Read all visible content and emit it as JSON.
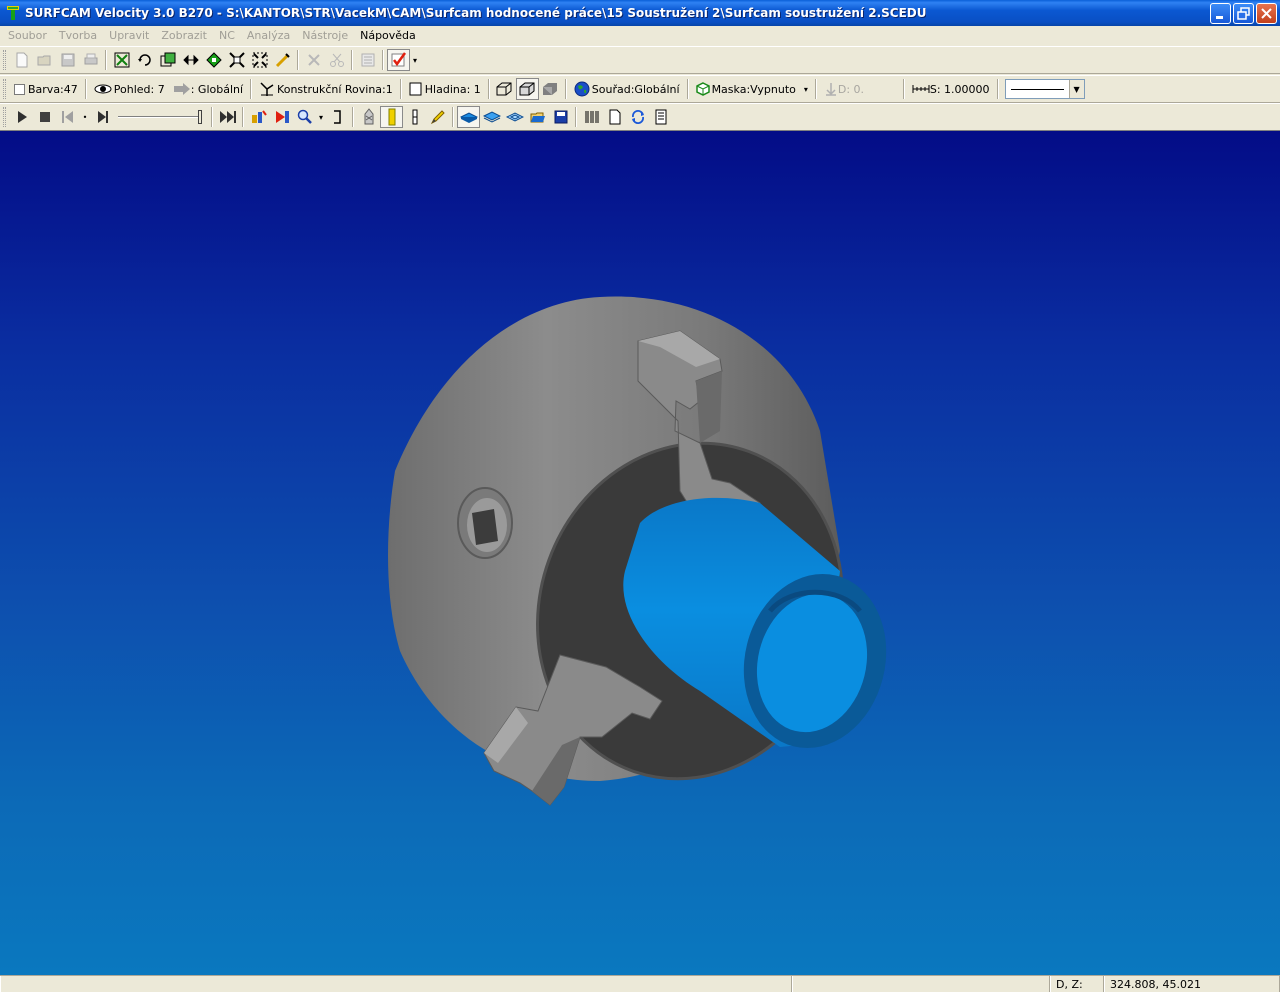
{
  "window": {
    "title": "SURFCAM Velocity 3.0 B270 - S:\\KANTOR\\STR\\VacekM\\CAM\\Surfcam hodnocené práce\\15 Soustružení 2\\Surfcam soustružení 2.SCEDU"
  },
  "menu": [
    {
      "label": "Soubor",
      "enabled": false
    },
    {
      "label": "Tvorba",
      "enabled": false
    },
    {
      "label": "Upravit",
      "enabled": false
    },
    {
      "label": "Zobrazit",
      "enabled": false
    },
    {
      "label": "NC",
      "enabled": false
    },
    {
      "label": "Analýza",
      "enabled": false
    },
    {
      "label": "Nástroje",
      "enabled": false
    },
    {
      "label": "Nápověda",
      "enabled": true
    }
  ],
  "toolbar2": {
    "color": "Barva:47",
    "view": "Pohled: 7",
    "cs": ": Globální",
    "cplane": "Konstrukční Rovina:1",
    "layer": "Hladina: 1",
    "coords": "Souřad:Globální",
    "mask": "Maska:Vypnuto",
    "depth": "D: 0.",
    "scale": "S: 1.00000"
  },
  "status": {
    "label": "D, Z:",
    "value": "324.808, 45.021"
  },
  "colors": {
    "part_gray": "#8c8c8c",
    "workpiece_blue": "#0a8ad6"
  }
}
